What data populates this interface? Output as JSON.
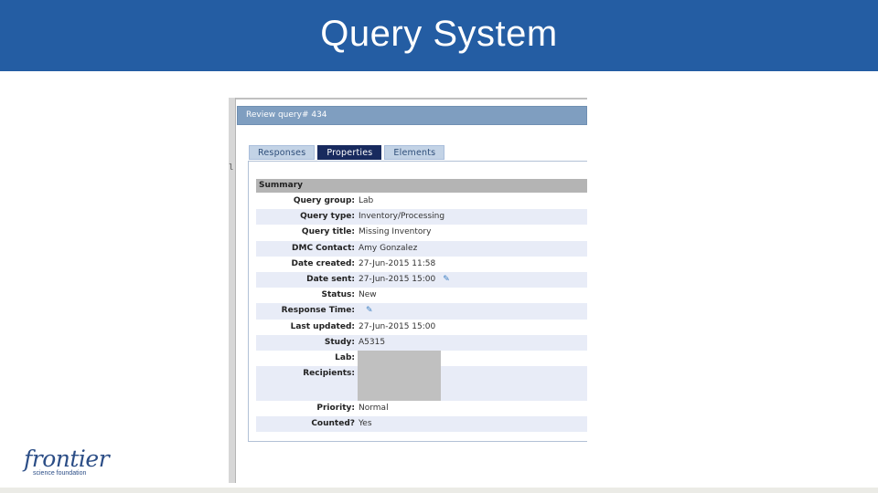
{
  "slide": {
    "title": "Query System",
    "logo": {
      "word": "frontier",
      "subtitle": "science foundation"
    }
  },
  "screenshot": {
    "left_glyph": "lc",
    "review_title": "Review query# 434",
    "tabs": [
      {
        "label": "Responses",
        "active": false
      },
      {
        "label": "Properties",
        "active": true
      },
      {
        "label": "Elements",
        "active": false
      }
    ],
    "summary_heading": "Summary",
    "fields": [
      {
        "label": "Query group:",
        "value": "Lab"
      },
      {
        "label": "Query type:",
        "value": "Inventory/Processing"
      },
      {
        "label": "Query title:",
        "value": "Missing Inventory"
      },
      {
        "label": "DMC Contact:",
        "value": "Amy Gonzalez"
      },
      {
        "label": "Date created:",
        "value": "27-Jun-2015 11:58"
      },
      {
        "label": "Date sent:",
        "value": "27-Jun-2015 15:00",
        "icon": "pencil-icon"
      },
      {
        "label": "Status:",
        "value": "New"
      },
      {
        "label": "Response Time:",
        "value": "",
        "icon": "pencil-icon"
      },
      {
        "label": "Last updated:",
        "value": "27-Jun-2015 15:00"
      },
      {
        "label": "Study:",
        "value": "A5315"
      },
      {
        "label": "Lab:",
        "value": ""
      },
      {
        "label": "Recipients:",
        "value": ""
      },
      {
        "label": "Priority:",
        "value": "Normal"
      },
      {
        "label": "Counted?",
        "value": "Yes"
      }
    ],
    "pencil_glyph": "✎"
  },
  "colors": {
    "header_bg": "#245da3",
    "active_tab": "#182a5e",
    "row_alt": "#e8ecf7"
  }
}
